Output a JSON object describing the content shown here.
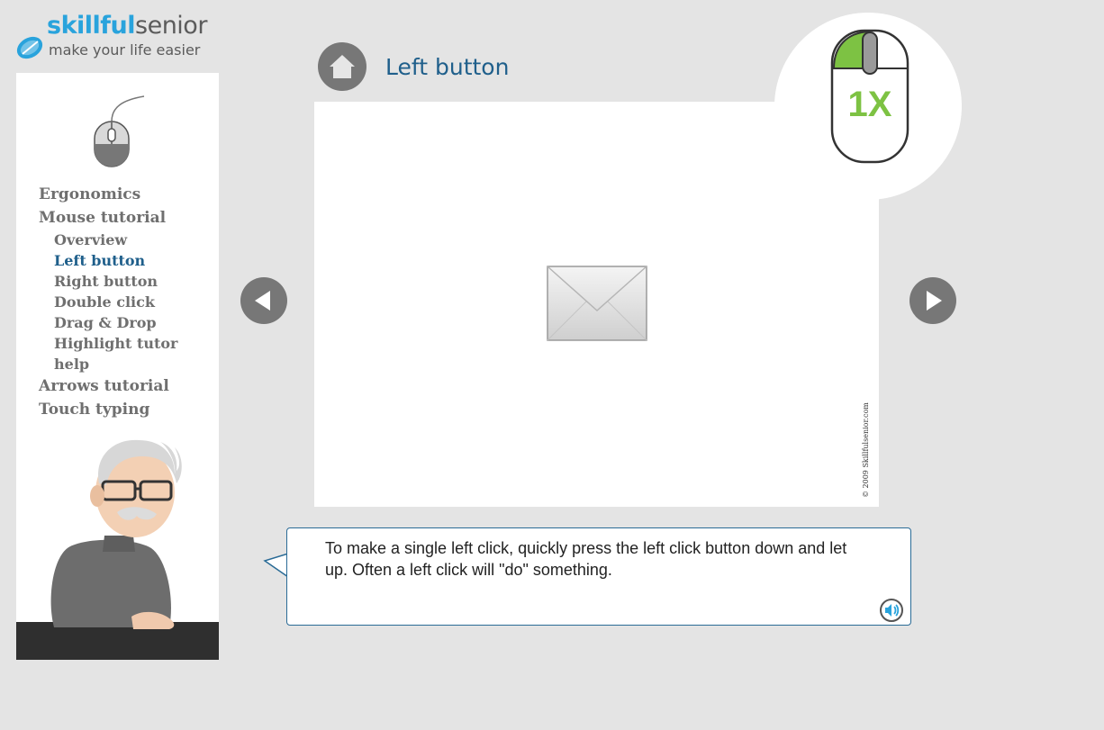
{
  "logo": {
    "brand_part1": "skillful",
    "brand_part2": "senior",
    "tagline": "make your life easier"
  },
  "sidebar": {
    "nav": [
      {
        "label": "Ergonomics",
        "level": 1,
        "active": false
      },
      {
        "label": "Mouse tutorial",
        "level": 1,
        "active": false
      },
      {
        "label": "Overview",
        "level": 2,
        "active": false
      },
      {
        "label": "Left button",
        "level": 2,
        "active": true
      },
      {
        "label": "Right button",
        "level": 2,
        "active": false
      },
      {
        "label": "Double click",
        "level": 2,
        "active": false
      },
      {
        "label": "Drag & Drop",
        "level": 2,
        "active": false
      },
      {
        "label": "Highlight tutor",
        "level": 2,
        "active": false
      },
      {
        "label": "help",
        "level": 2,
        "active": false
      },
      {
        "label": "Arrows tutorial",
        "level": 1,
        "active": false
      },
      {
        "label": "Touch typing",
        "level": 1,
        "active": false
      }
    ]
  },
  "header": {
    "title": "Left button"
  },
  "stage": {
    "copyright": "© 2009 Skillfulsenior.com"
  },
  "badge": {
    "count": "1X"
  },
  "instruction": {
    "text": "To make a single left click, quickly press the left click button down and let up. Often a left click will \"do\" something."
  },
  "icons": {
    "home": "home-icon",
    "prev": "arrow-left-icon",
    "next": "arrow-right-icon",
    "envelope": "envelope-icon",
    "audio": "speaker-icon",
    "mouse": "mouse-icon"
  },
  "colors": {
    "background": "#e4e4e4",
    "accent_blue": "#1f5f8b",
    "brand_blue": "#29a3dc",
    "click_green": "#7dc243",
    "nav_gray": "#6f6f6f",
    "button_gray": "#777777"
  }
}
